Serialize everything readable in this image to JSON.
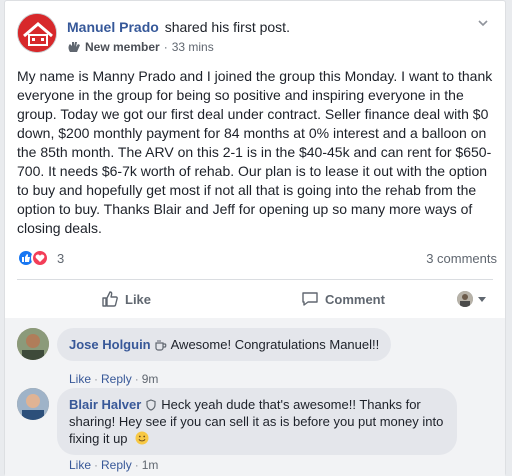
{
  "post": {
    "author": "Manuel Prado",
    "action": "shared his first post.",
    "badge": "New member",
    "time": "33 mins",
    "text": "My name is Manny Prado and I joined the group this Monday. I want to thank everyone in the group for being so positive and inspiring everyone in the group. Today we got our first deal under contract. Seller finance deal with $0 down, $200 monthly payment for 84 months at 0% interest and a balloon on the 85th month. The ARV on this 2-1 is in the $40-45k and can rent for $650-700. It needs $6-7k worth of rehab. Our plan is to lease it out with the option to buy and hopefully get most if not all that is going into the rehab from the option to buy. Thanks Blair and Jeff for opening up so many more ways of closing deals.",
    "reaction_count": "3",
    "comment_count": "3 comments"
  },
  "actions": {
    "like_label": "Like",
    "comment_label": "Comment"
  },
  "comments": [
    {
      "name": "Jose Holguin",
      "text": "Awesome! Congratulations Manuel!!",
      "like": "Like",
      "reply": "Reply",
      "time": "9m"
    },
    {
      "name": "Blair Halver",
      "text": "Heck yeah dude that's awesome!! Thanks for sharing! Hey see if you can sell it as is before you put money into fixing it up",
      "like": "Like",
      "reply": "Reply",
      "time": "1m"
    }
  ],
  "colors": {
    "link": "#365899",
    "like_blue": "#1877f2",
    "love_red": "#f33e58",
    "brand_red": "#d7282b"
  }
}
